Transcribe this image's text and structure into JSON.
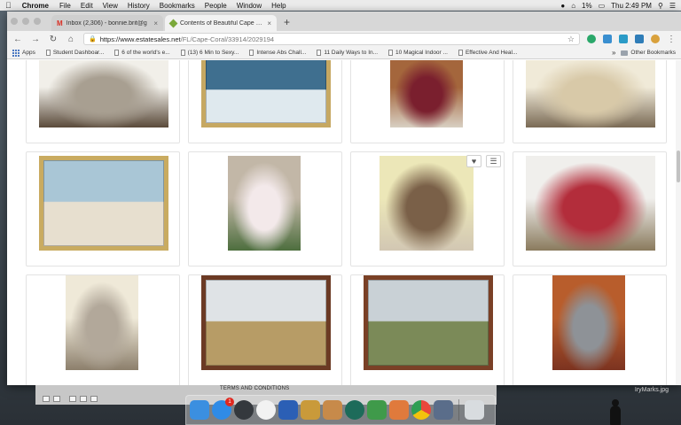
{
  "menubar": {
    "app_name": "Chrome",
    "menus": [
      "File",
      "Edit",
      "View",
      "History",
      "Bookmarks",
      "People",
      "Window",
      "Help"
    ],
    "battery": "1%",
    "clock": "Thu 2:49 PM"
  },
  "tabs": [
    {
      "label": "Inbox (2,306) - bonnie.brit@g",
      "favicon": "gmail-icon"
    },
    {
      "label": "Contents of Beautiful Cape Co",
      "favicon": "tag-icon"
    }
  ],
  "address_bar": {
    "host": "https://www.estatesales.net",
    "path": "/FL/Cape-Coral/33914/2029194"
  },
  "bookmarks": {
    "apps_label": "Apps",
    "items": [
      "Student Dashboar...",
      "6 of the world's e...",
      "(13) 6 Min to Sexy...",
      "Intense Abs Chall...",
      "11 Daily Ways to In...",
      "10 Magical Indoor ...",
      "Effective And Heal..."
    ],
    "more": "»",
    "other": "Other Bookmarks"
  },
  "gallery": {
    "photos": [
      {
        "subject": "sectional-sofa",
        "colors": [
          "#f1efe9",
          "#a89f91",
          "#5a4a3a"
        ]
      },
      {
        "subject": "ocean-wave-painting",
        "colors": [
          "#c6a862",
          "#3f6f8f",
          "#dfe9ee"
        ]
      },
      {
        "subject": "dining-chairs",
        "colors": [
          "#a4663c",
          "#7a1f2e",
          "#d8cfc2"
        ]
      },
      {
        "subject": "white-dresser",
        "colors": [
          "#f0ead8",
          "#d8c9a8",
          "#7a6a55"
        ]
      },
      {
        "subject": "beach-palm-painting",
        "colors": [
          "#c9ab60",
          "#a9c6d6",
          "#e7dfcf"
        ]
      },
      {
        "subject": "flower-vase",
        "colors": [
          "#c2b7a7",
          "#f3e9ea",
          "#4d6e3e"
        ]
      },
      {
        "subject": "cream-nightstand",
        "colors": [
          "#ece7b8",
          "#7a6048",
          "#d2c7b3"
        ]
      },
      {
        "subject": "floral-bed",
        "colors": [
          "#f0efec",
          "#b32d3b",
          "#8a7a5d"
        ]
      },
      {
        "subject": "vanity-mirror-dresser",
        "colors": [
          "#efe9d8",
          "#b2a89a",
          "#8c7f6c"
        ]
      },
      {
        "subject": "ducks-painting",
        "colors": [
          "#6b3a24",
          "#dfe3e6",
          "#b79c66"
        ]
      },
      {
        "subject": "landscape-birds-painting",
        "colors": [
          "#7a4026",
          "#c9d1d6",
          "#7b8a58"
        ]
      },
      {
        "subject": "end-table",
        "colors": [
          "#b85d2c",
          "#8e9297",
          "#7c3320"
        ]
      }
    ],
    "favorite_icon": "heart-icon",
    "menu_icon": "hamburger-menu-icon"
  },
  "backdrop": {
    "terms_text": "TERMS AND CONDITIONS",
    "desktop_file": "IryMarks.jpg"
  },
  "dock": {
    "apps": [
      {
        "name": "finder-icon",
        "color": "#3b8fe0"
      },
      {
        "name": "app-store-icon",
        "color": "#2f8be6",
        "badge": "1"
      },
      {
        "name": "launchpad-icon",
        "color": "#34383d"
      },
      {
        "name": "itunes-icon",
        "color": "#f2f2f2"
      },
      {
        "name": "word-icon",
        "color": "#2b5fb5"
      },
      {
        "name": "notes-icon",
        "color": "#c99a3a"
      },
      {
        "name": "contacts-icon",
        "color": "#c78a4a"
      },
      {
        "name": "time-machine-icon",
        "color": "#1d6b5a"
      },
      {
        "name": "tool-icon",
        "color": "#3f9a4a"
      },
      {
        "name": "paintbrush-icon",
        "color": "#e07a3c"
      },
      {
        "name": "chrome-icon",
        "color": "#e9473b"
      },
      {
        "name": "pen-icon",
        "color": "#5a6d8a"
      },
      {
        "name": "trash-icon",
        "color": "#d8dcdf"
      }
    ]
  }
}
